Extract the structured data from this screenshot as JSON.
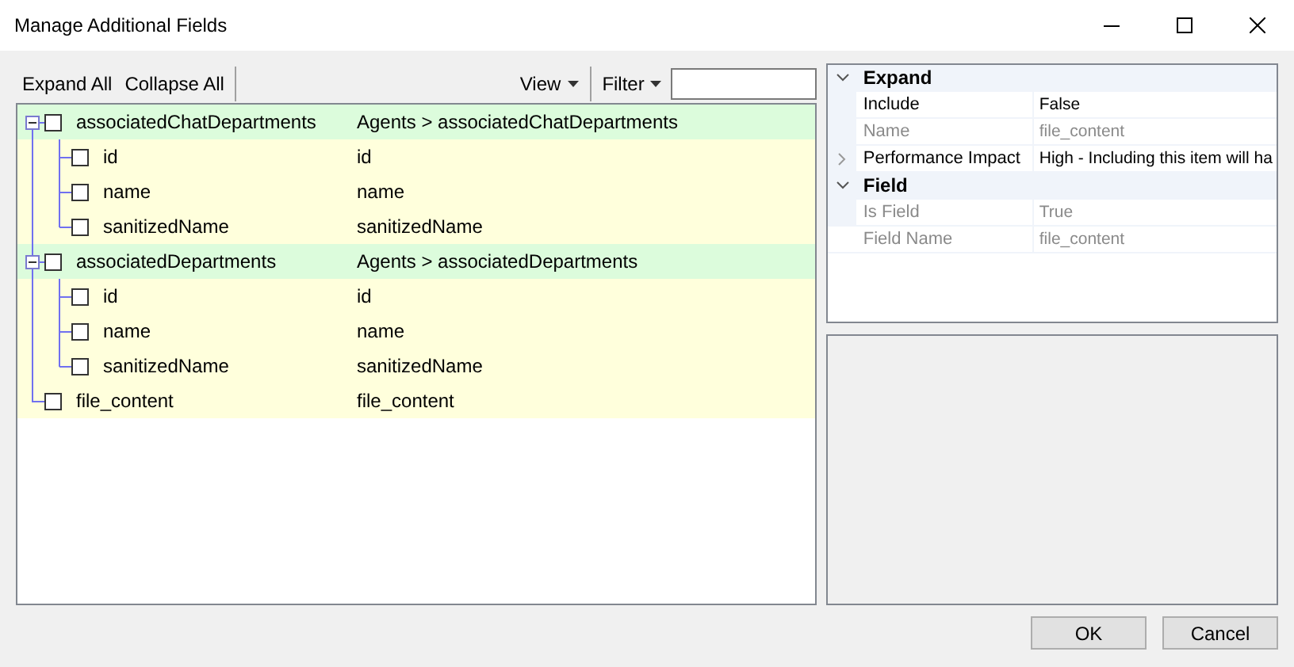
{
  "window": {
    "title": "Manage Additional Fields"
  },
  "toolbar": {
    "expand_all": "Expand All",
    "collapse_all": "Collapse All",
    "view": "View",
    "filter": "Filter"
  },
  "tree": {
    "items": [
      {
        "label": "associatedChatDepartments",
        "path": "Agents > associatedChatDepartments",
        "checked": false,
        "expanded": true,
        "children": [
          {
            "label": "id",
            "path": "id",
            "checked": false
          },
          {
            "label": "name",
            "path": "name",
            "checked": false
          },
          {
            "label": "sanitizedName",
            "path": "sanitizedName",
            "checked": false
          }
        ]
      },
      {
        "label": "associatedDepartments",
        "path": "Agents > associatedDepartments",
        "checked": false,
        "expanded": true,
        "children": [
          {
            "label": "id",
            "path": "id",
            "checked": false
          },
          {
            "label": "name",
            "path": "name",
            "checked": false
          },
          {
            "label": "sanitizedName",
            "path": "sanitizedName",
            "checked": false
          }
        ]
      },
      {
        "label": "file_content",
        "path": "file_content",
        "checked": false
      }
    ]
  },
  "properties": {
    "categories": [
      {
        "name": "Expand",
        "expanded": true,
        "items": [
          {
            "name": "Include",
            "value": "False",
            "disabled": false,
            "expandable": false
          },
          {
            "name": "Name",
            "value": "file_content",
            "disabled": true,
            "expandable": false
          },
          {
            "name": "Performance Impact",
            "value": "High - Including this item will ha",
            "disabled": false,
            "expandable": true
          }
        ]
      },
      {
        "name": "Field",
        "expanded": true,
        "items": [
          {
            "name": "Is Field",
            "value": "True",
            "disabled": true,
            "expandable": false
          },
          {
            "name": "Field Name",
            "value": "file_content",
            "disabled": true,
            "expandable": false
          }
        ]
      }
    ]
  },
  "buttons": [
    {
      "label": "OK"
    },
    {
      "label": "Cancel"
    }
  ]
}
